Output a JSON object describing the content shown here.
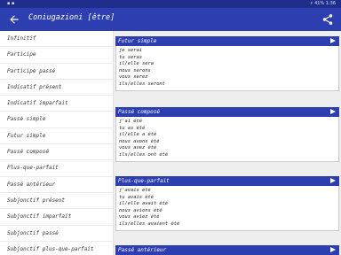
{
  "status": {
    "right_text": "⚡ 41%  1:36"
  },
  "appbar": {
    "title": "Coniugazioni [être]"
  },
  "sidebar": {
    "items": [
      "Infinitif",
      "Participe",
      "Participe passé",
      "Indicatif présent",
      "Indicatif imparfait",
      "Passé simple",
      "Futur simple",
      "Passé composé",
      "Plus-que-parfait",
      "Passé antérieur",
      "Subjonctif présent",
      "Subjonctif imparfait",
      "Subjonctif passé",
      "Subjonctif plus-que-parfait"
    ]
  },
  "cards": [
    {
      "title": "Futur simple",
      "lines": [
        "je serai",
        "tu seras",
        "il/elle sera",
        "nous serons",
        "vous serez",
        "ils/elles seront"
      ]
    },
    {
      "title": "Passé composé",
      "lines": [
        "j'ai été",
        "tu as été",
        "il/elle a été",
        "nous avons été",
        "vous avez été",
        "ils/elles ont été"
      ]
    },
    {
      "title": "Plus-que-parfait",
      "lines": [
        "j'avais été",
        "tu avais été",
        "il/elle avait été",
        "nous avions été",
        "vous aviez été",
        "ils/elles avaient été"
      ]
    },
    {
      "title": "Passé antérieur",
      "lines": []
    }
  ]
}
